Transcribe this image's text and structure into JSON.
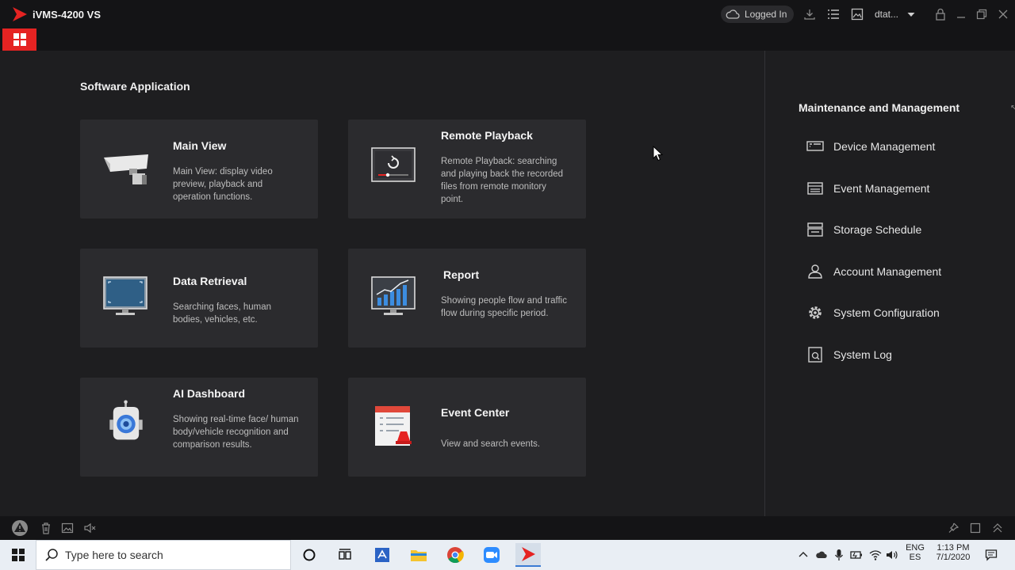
{
  "app": {
    "title": "iVMS-4200 VS",
    "brand_color": "#e52322"
  },
  "titlebar": {
    "login_status": "Logged In",
    "user": "dtat...",
    "icons": [
      "cloud-icon",
      "download-icon",
      "task-list-icon",
      "picture-icon",
      "dropdown-icon",
      "lock-icon",
      "minimize-icon",
      "restore-icon",
      "close-icon"
    ]
  },
  "home_tab": {
    "icon": "grid-icon"
  },
  "software": {
    "title": "Software Application",
    "cards": [
      {
        "title": "Main View",
        "desc": "Main View: display video preview, playback and operation functions."
      },
      {
        "title": "Remote Playback",
        "desc": "Remote Playback: searching and playing back the recorded files from remote monitory point."
      },
      {
        "title": "Data Retrieval",
        "desc": "Searching faces, human bodies, vehicles, etc."
      },
      {
        "title": "Report",
        "desc": "Showing people flow and traffic flow during specific period."
      },
      {
        "title": "AI Dashboard",
        "desc": "Showing real-time face/ human body/vehicle recognition and comparison results."
      },
      {
        "title": "Event Center",
        "desc": "View and search events."
      }
    ]
  },
  "maintenance": {
    "title": "Maintenance and Management",
    "items": [
      {
        "label": "Device Management",
        "icon": "device-icon"
      },
      {
        "label": "Event Management",
        "icon": "event-list-icon"
      },
      {
        "label": "Storage Schedule",
        "icon": "storage-icon"
      },
      {
        "label": "Account Management",
        "icon": "user-icon"
      },
      {
        "label": "System Configuration",
        "icon": "gear-icon"
      },
      {
        "label": "System Log",
        "icon": "log-icon"
      }
    ]
  },
  "statusbar": {
    "icons": [
      "alarm-warning-icon",
      "trash-icon",
      "picture-icon",
      "mute-icon",
      "pin-icon",
      "window-icon",
      "expand-up-icon"
    ]
  },
  "taskbar": {
    "search_placeholder": "Type here to search",
    "lang_top": "ENG",
    "lang_bottom": "ES",
    "time": "1:13 PM",
    "date": "7/1/2020"
  }
}
